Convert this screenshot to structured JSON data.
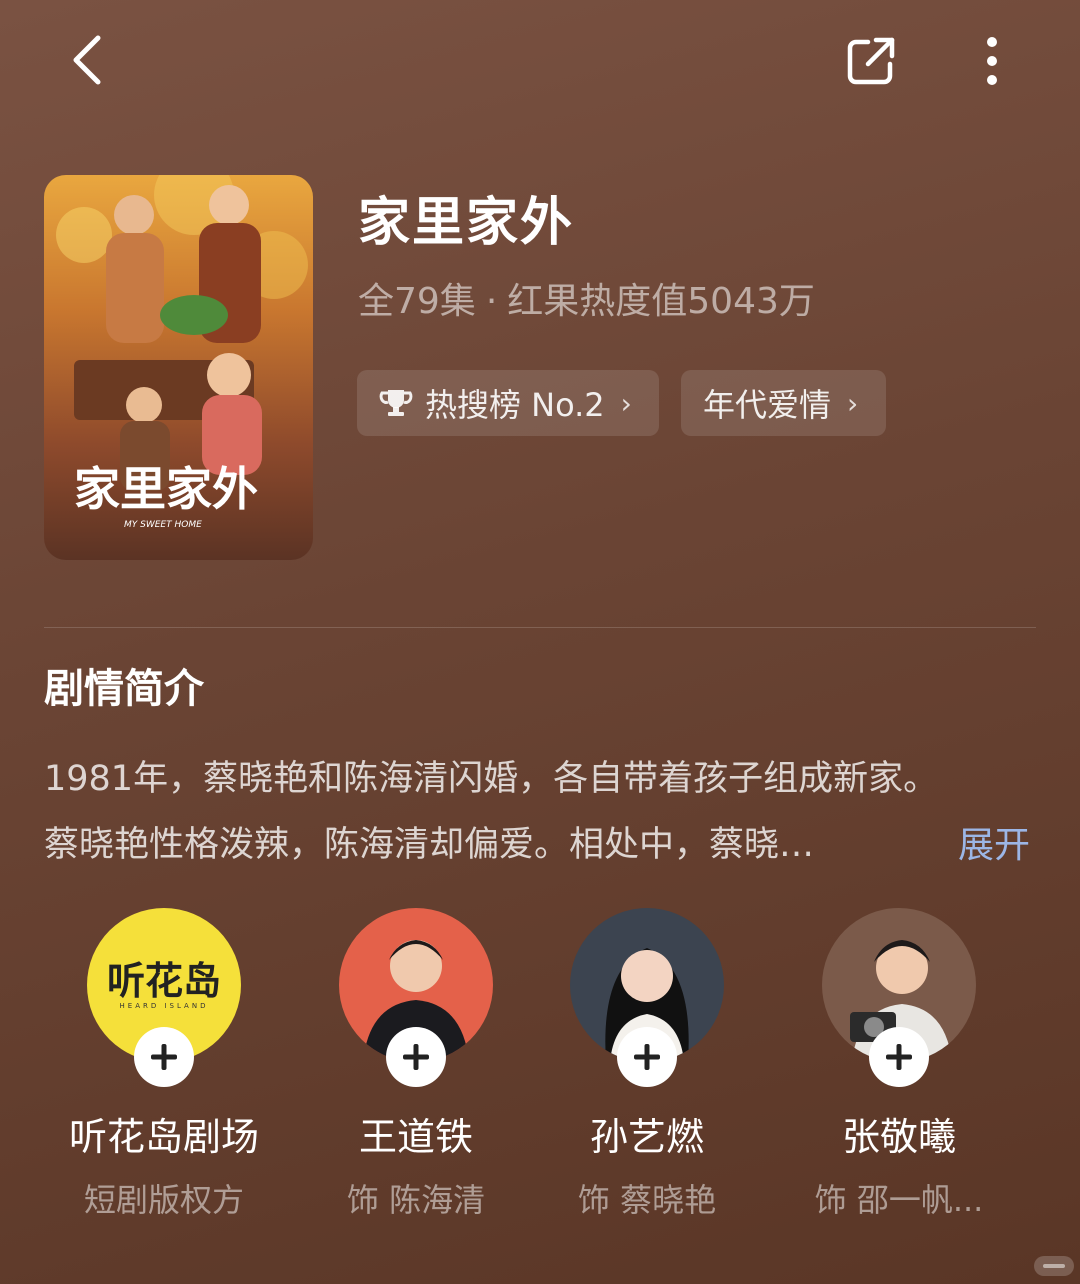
{
  "header": {
    "back_icon": "chevron-left-icon",
    "share_icon": "share-icon",
    "more_icon": "more-vertical-icon"
  },
  "show": {
    "title": "家里家外",
    "episodes": "全79集",
    "separator": "·",
    "heat": "红果热度值5043万",
    "poster_title": "家里家外",
    "poster_subtitle": "MY SWEET HOME"
  },
  "tags": [
    {
      "icon": "trophy-icon",
      "label": "热搜榜 No.2"
    },
    {
      "label": "年代爱情"
    }
  ],
  "synopsis": {
    "heading": "剧情简介",
    "line1": "1981年，蔡晓艳和陈海清闪婚，各自带着孩子组成新家。",
    "line2": "蔡晓艳性格泼辣，陈海清却偏爱。相处中，蔡晓…",
    "expand": "展开"
  },
  "cast": [
    {
      "name": "听花岛剧场",
      "role": "短剧版权方",
      "logo_text": "听花岛",
      "logo_subtext": "HEARD ISLAND"
    },
    {
      "name": "王道铁",
      "role": "饰 陈海清"
    },
    {
      "name": "孙艺燃",
      "role": "饰 蔡晓艳"
    },
    {
      "name": "张敬曦",
      "role": "饰 邵一帆..."
    }
  ],
  "colors": {
    "background": "#6a4434",
    "accent_link": "#9cb6e6",
    "logo_yellow": "#f5e03a"
  }
}
